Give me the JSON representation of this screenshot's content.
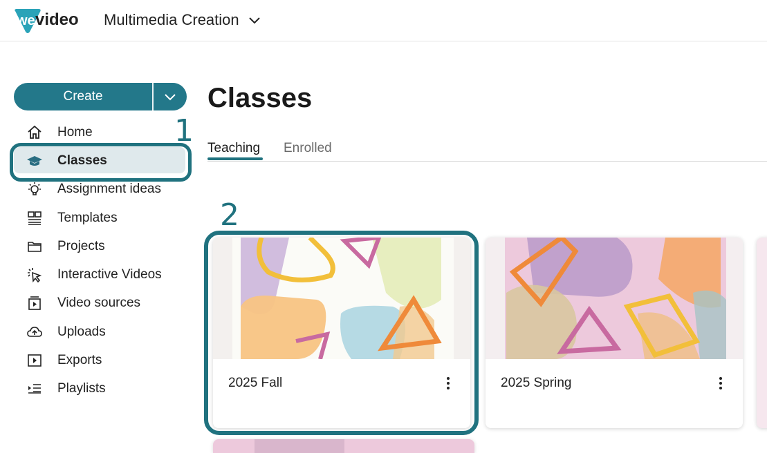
{
  "app": {
    "logo_text": "wevideo",
    "workspace": "Multimedia Creation"
  },
  "sidebar": {
    "create_label": "Create",
    "items": [
      {
        "label": "Home",
        "icon": "home-icon"
      },
      {
        "label": "Classes",
        "icon": "graduation-cap-icon",
        "active": true
      },
      {
        "label": "Assignment ideas",
        "icon": "lightbulb-icon"
      },
      {
        "label": "Templates",
        "icon": "templates-icon"
      },
      {
        "label": "Projects",
        "icon": "folder-icon"
      },
      {
        "label": "Interactive Videos",
        "icon": "pointer-click-icon"
      },
      {
        "label": "Video sources",
        "icon": "video-sources-icon"
      },
      {
        "label": "Uploads",
        "icon": "cloud-upload-icon"
      },
      {
        "label": "Exports",
        "icon": "export-icon"
      },
      {
        "label": "Playlists",
        "icon": "playlist-icon"
      }
    ]
  },
  "main": {
    "title": "Classes",
    "tabs": [
      {
        "label": "Teaching",
        "active": true
      },
      {
        "label": "Enrolled",
        "active": false
      }
    ],
    "classes": [
      {
        "name": "2025 Fall"
      },
      {
        "name": "2025 Spring"
      }
    ]
  },
  "annotations": {
    "marker_1": "1",
    "marker_2": "2"
  },
  "colors": {
    "accent": "#23788a",
    "highlight": "#20727f",
    "active_bg": "#dfe9ec"
  }
}
